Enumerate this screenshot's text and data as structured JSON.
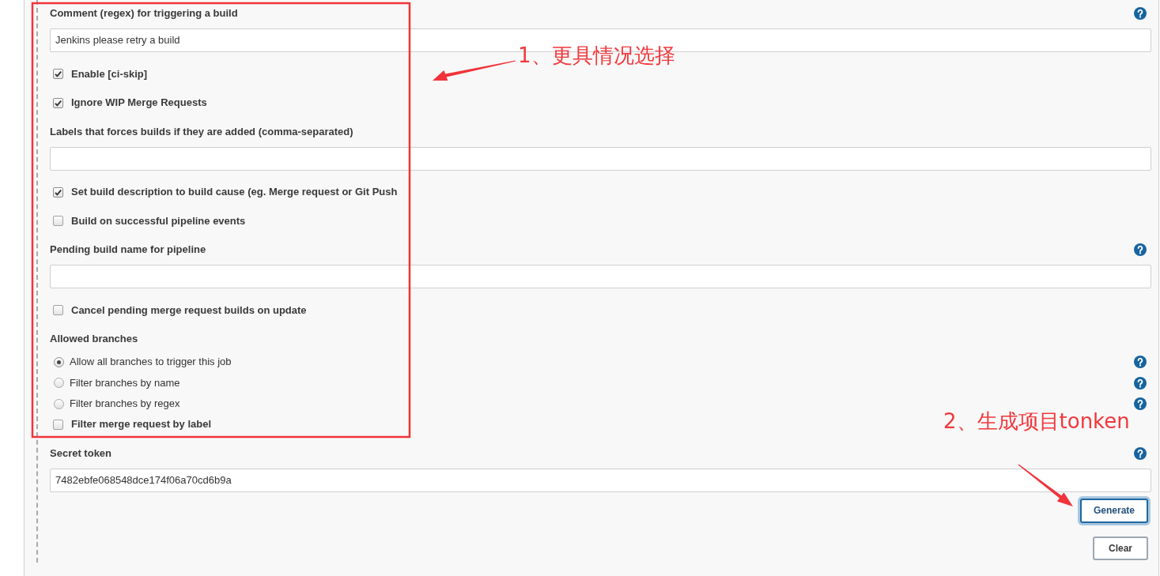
{
  "fields": [
    {
      "kind": "text",
      "label": "Comment (regex) for triggering a build",
      "help": true,
      "value": "Jenkins please retry a build"
    },
    {
      "kind": "checkbox",
      "label": "Enable [ci-skip]",
      "checked": true,
      "help": false
    },
    {
      "kind": "checkbox",
      "label": "Ignore WIP Merge Requests",
      "checked": true,
      "help": false
    },
    {
      "kind": "text",
      "label": "Labels that forces builds if they are added (comma-separated)",
      "help": false
    },
    {
      "kind": "checkbox",
      "label": "Set build description to build cause (eg. Merge request or Git Push",
      "checked": true,
      "help": false
    },
    {
      "kind": "checkbox",
      "label": "Build on successful pipeline events",
      "checked": false,
      "help": false
    },
    {
      "kind": "text",
      "label": "Pending build name for pipeline",
      "help": true
    },
    {
      "kind": "checkbox",
      "label": "Cancel pending merge request builds on update",
      "checked": false,
      "help": false
    },
    {
      "kind": "heading",
      "label": "Allowed branches",
      "help": false
    },
    {
      "kind": "radio",
      "label": "Allow all branches to trigger this job",
      "selected": true,
      "help": true
    },
    {
      "kind": "radio",
      "label": "Filter branches by name",
      "selected": false,
      "help": true
    },
    {
      "kind": "radio",
      "label": "Filter branches by regex",
      "selected": false,
      "help": true
    },
    {
      "kind": "checkbox",
      "label": "Filter merge request by label",
      "checked": false,
      "help": false
    },
    {
      "kind": "text",
      "label": "Secret token",
      "help": true,
      "value": "7482ebfe068548dce174f06a70cd6b9a"
    }
  ],
  "token_buttons": [
    {
      "label": "Generate",
      "focused": true
    },
    {
      "label": "Clear",
      "focused": false
    }
  ],
  "annotations": [
    {
      "text": "1、更具情况选择"
    },
    {
      "text": "2、生成项目tonken"
    }
  ]
}
